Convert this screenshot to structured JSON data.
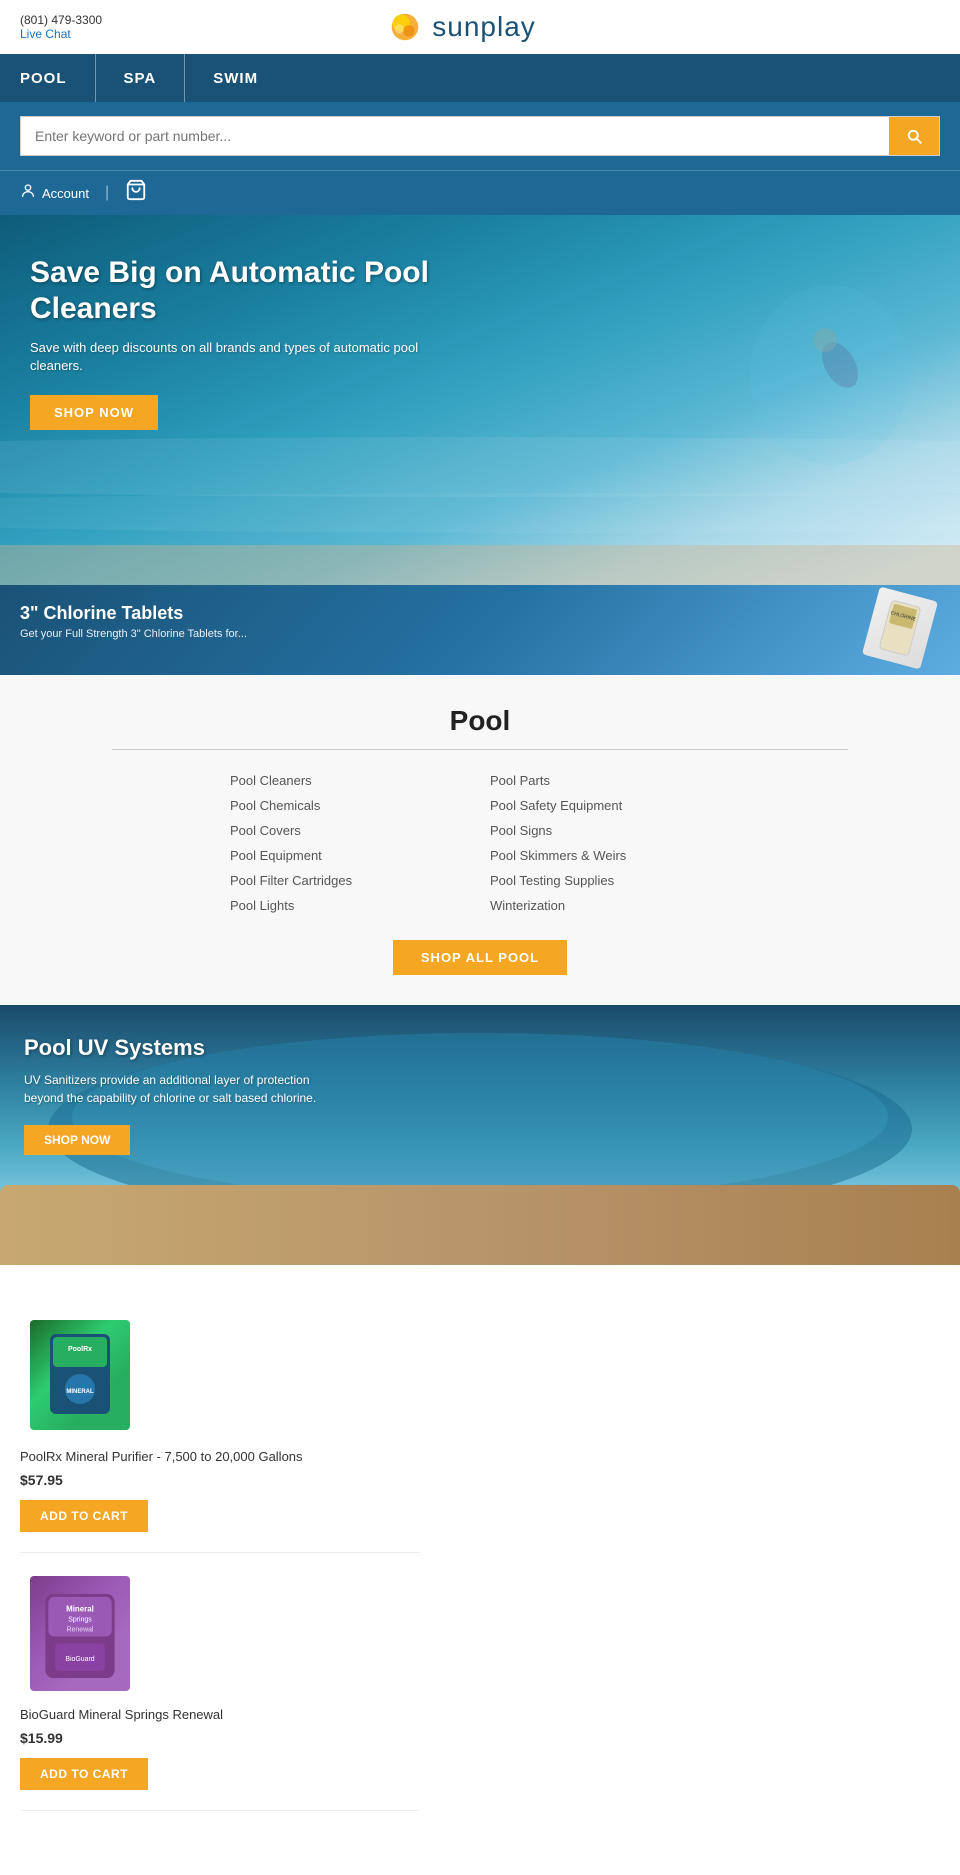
{
  "site": {
    "name": "sunplay",
    "phone": "(801) 479-3300",
    "live_chat": "Live Chat"
  },
  "nav": {
    "items": [
      {
        "label": "POOL",
        "id": "pool"
      },
      {
        "label": "SPA",
        "id": "spa"
      },
      {
        "label": "SWIM",
        "id": "swim"
      }
    ]
  },
  "search": {
    "placeholder": "Enter keyword or part number..."
  },
  "account": {
    "label": "Account"
  },
  "hero": {
    "title": "Save Big on Automatic Pool Cleaners",
    "subtitle": "Save with deep discounts on all brands and types of automatic pool cleaners.",
    "button_label": "SHOP NOW"
  },
  "chlorine_banner": {
    "title": "3\" Chlorine Tablets",
    "subtitle": "Get your Full Strength 3\" Chlorine Tablets for..."
  },
  "pool_section": {
    "title": "Pool",
    "categories_left": [
      "Pool Cleaners",
      "Pool Chemicals",
      "Pool Covers",
      "Pool Equipment",
      "Pool Filter Cartridges",
      "Pool Lights"
    ],
    "categories_right": [
      "Pool Parts",
      "Pool Safety Equipment",
      "Pool Signs",
      "Pool Skimmers & Weirs",
      "Pool Testing Supplies",
      "Winterization"
    ],
    "shop_all_label": "SHOP ALL POOL"
  },
  "uv_banner": {
    "title": "Pool UV Systems",
    "subtitle": "UV Sanitizers provide an additional layer of protection beyond the capability of chlorine or salt based chlorine.",
    "button_label": "SHOP NOW"
  },
  "products": [
    {
      "id": "poolrx",
      "name": "PoolRx Mineral Purifier - 7,500 to 20,000 Gallons",
      "price": "$57.95",
      "button_label": "ADD TO CART",
      "img_label": "PoolRx"
    },
    {
      "id": "bioguard",
      "name": "BioGuard Mineral Springs Renewal",
      "price": "$15.99",
      "button_label": "ADD TO CART",
      "img_label": "BioGuard"
    }
  ]
}
